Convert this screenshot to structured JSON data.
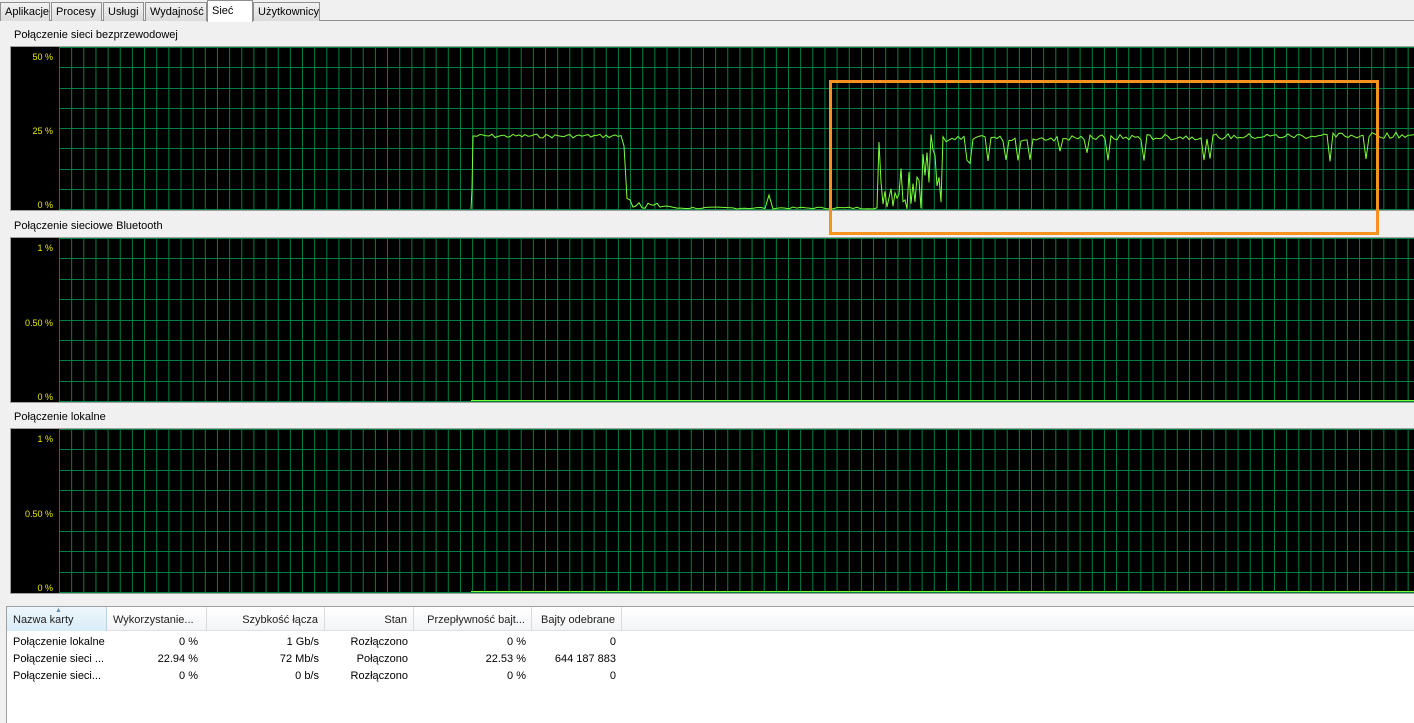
{
  "tabs": [
    {
      "label": "Aplikacje",
      "active": false
    },
    {
      "label": "Procesy",
      "active": false
    },
    {
      "label": "Usługi",
      "active": false
    },
    {
      "label": "Wydajność",
      "active": false
    },
    {
      "label": "Sieć",
      "active": true
    },
    {
      "label": "Użytkownicy",
      "active": false
    }
  ],
  "graphs": [
    {
      "title": "Połączenie sieci bezprzewodowej",
      "y_labels": [
        "50 %",
        "25 %",
        "0 %"
      ]
    },
    {
      "title": "Połączenie sieciowe Bluetooth",
      "y_labels": [
        "1 %",
        "0.50 %",
        "0 %"
      ]
    },
    {
      "title": "Połączenie lokalne",
      "y_labels": [
        "1 %",
        "0.50 %",
        "0 %"
      ]
    }
  ],
  "colors": {
    "graph_bg": "#000000",
    "grid": "#008040",
    "trace": "#7cff3a",
    "axis_label": "#e8e800",
    "highlight": "#f7921e"
  },
  "table": {
    "columns": [
      "Nazwa karty",
      "Wykorzystanie...",
      "Szybkość łącza",
      "Stan",
      "Przepływność bajt...",
      "Bajty odebrane"
    ],
    "sorted_column": 0,
    "rows": [
      [
        "Połączenie lokalne",
        "0 %",
        "1 Gb/s",
        "Rozłączono",
        "0 %",
        "0"
      ],
      [
        "Połączenie sieci ...",
        "22.94 %",
        "72 Mb/s",
        "Połączono",
        "22.53 %",
        "644 187 883"
      ],
      [
        "Połączenie sieci...",
        "0 %",
        "0 b/s",
        "Rozłączono",
        "0 %",
        "0"
      ]
    ]
  }
}
